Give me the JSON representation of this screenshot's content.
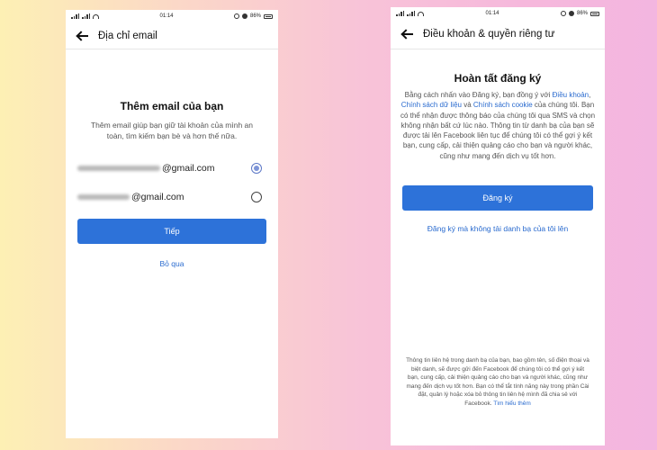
{
  "left": {
    "status": {
      "carrier": "3GVoLTE",
      "time": "01:14",
      "battery": "86%"
    },
    "app_bar": {
      "title": "Địa chỉ email"
    },
    "heading": "Thêm email của bạn",
    "subtitle": "Thêm email giúp bạn giữ tài khoản của mình an toàn, tìm kiếm bạn bè và hơn thế nữa.",
    "emails": [
      {
        "visible_part": "@gmail.com",
        "selected": true
      },
      {
        "visible_part": "@gmail.com",
        "selected": false
      }
    ],
    "next_button": "Tiếp",
    "skip_link": "Bỏ qua"
  },
  "right": {
    "status": {
      "carrier": "3GVoLTE",
      "time": "01:14",
      "battery": "86%"
    },
    "app_bar": {
      "title": "Điều khoản & quyền riêng tư"
    },
    "heading": "Hoàn tất đăng ký",
    "terms": {
      "part1": "Bằng cách nhấn vào Đăng ký, bạn đồng ý với ",
      "link1": "Điều khoản",
      "sep1": ", ",
      "link2": "Chính sách dữ liệu",
      "sep2": " và ",
      "link3": "Chính sách cookie",
      "part2": " của chúng tôi. Bạn có thể nhận được thông báo của chúng tôi qua SMS và chọn không nhận bất cứ lúc nào. Thông tin từ danh bạ của bạn sẽ được tải lên Facebook liên tục để chúng tôi có thể gợi ý kết bạn, cung cấp, cải thiện quảng cáo cho bạn và người khác, cũng như mang đến dịch vụ tốt hơn."
    },
    "signup_button": "Đăng ký",
    "signup_without_contacts": "Đăng ký mà không tải danh bạ của tôi lên",
    "footer": {
      "text": "Thông tin liên hệ trong danh bạ của bạn, bao gồm tên, số điện thoại và biệt danh, sẽ được gửi đến Facebook để chúng tôi có thể gợi ý kết bạn, cung cấp, cải thiện quảng cáo cho bạn và người khác, cũng như mang đến dịch vụ tốt hơn. Bạn có thể tắt tính năng này trong phần Cài đặt, quản lý hoặc xóa bỏ thông tin liên hệ mình đã chia sẻ với Facebook. ",
      "learn_more": "Tìm hiểu thêm"
    }
  },
  "colors": {
    "primary": "#2d72d9",
    "link": "#2a6bcf"
  }
}
